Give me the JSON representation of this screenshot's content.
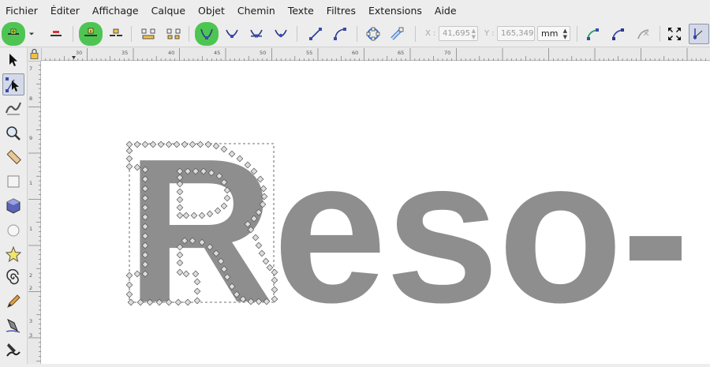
{
  "menu": [
    "Fichier",
    "Éditer",
    "Affichage",
    "Calque",
    "Objet",
    "Chemin",
    "Texte",
    "Filtres",
    "Extensions",
    "Aide"
  ],
  "toolbar": {
    "x_label": "X :",
    "x_value": "41,695",
    "y_label": "Y :",
    "y_value": "165,349",
    "unit": "mm"
  },
  "ruler": {
    "h_labels": [
      "30",
      "35",
      "40",
      "45",
      "50",
      "55",
      "60",
      "65",
      "70"
    ],
    "v_labels": [
      "7",
      "8",
      "9",
      "1",
      "1",
      "2",
      "2",
      "3",
      "3"
    ]
  },
  "canvas": {
    "text": "Reso-",
    "fill_color": "#8e8e8e"
  },
  "colors": {
    "active_tool_green": "#4ec552",
    "node_fill": "#dddddd"
  }
}
